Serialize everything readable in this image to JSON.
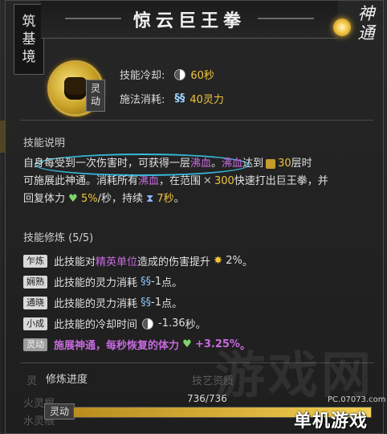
{
  "skill": {
    "title": "惊云巨王拳",
    "realm_chars": [
      "筑",
      "基",
      "境"
    ],
    "category_chars": [
      "神",
      "通"
    ],
    "badge": "灵动",
    "cooldown_label": "技能冷却:",
    "cooldown_value": "60秒",
    "cost_label": "施法消耗:",
    "cost_value": "40灵力"
  },
  "description": {
    "heading": "技能说明",
    "line1_a": "自身每受到一次伤害时，可获得一层",
    "line1_hl": "沸血",
    "line1_b": "。",
    "line1_hl2": "沸血",
    "line1_c": "达到",
    "line1_num": "30",
    "line1_d": "层时",
    "line2_a": "可施展此神通。消耗所有",
    "line2_hl": "沸血",
    "line2_b": "，在范围",
    "line2_num": "300",
    "line2_c": "快速打出巨王拳，并",
    "line3_a": "回复体力",
    "line3_num": "5%",
    "line3_b": "/秒，持续",
    "line3_num2": "7秒",
    "line3_c": "。"
  },
  "training": {
    "heading": "技能修炼 (5/5)",
    "rows": [
      {
        "tag": "乍炼",
        "a": "此技能对",
        "hl": "精英单位",
        "b": "造成的伤害提升",
        "num": "2%",
        "c": "。"
      },
      {
        "tag": "娴熟",
        "a": "此技能的灵力消耗",
        "hl": "",
        "b": "",
        "num": "-1",
        "c": "点。"
      },
      {
        "tag": "通晓",
        "a": "此技能的灵力消耗",
        "hl": "",
        "b": "",
        "num": "-1",
        "c": "点。"
      },
      {
        "tag": "小成",
        "a": "此技能的冷却时间",
        "hl": "",
        "b": "",
        "num": "-1.36",
        "c": "秒。"
      },
      {
        "tag": "灵动",
        "a": "施展神通，每秒恢复的体力",
        "hl": "",
        "b": "",
        "num": "+3.25%",
        "c": "。"
      }
    ]
  },
  "progress": {
    "label": "修炼进度",
    "value_text": "736/736",
    "fraction": 1.0,
    "tag": "灵动"
  },
  "background": {
    "left_item1": "火灵根",
    "left_item2": "水灵根",
    "right_tab": "技艺资质",
    "left_tab": "灵"
  },
  "watermark": {
    "big": "游戏网",
    "site": "PC.07073.com",
    "brand": "单机游戏"
  },
  "colors": {
    "accent_gold": "#f0c43a",
    "highlight_purple": "#c86ae0",
    "ring_cyan": "#35b8d9"
  }
}
